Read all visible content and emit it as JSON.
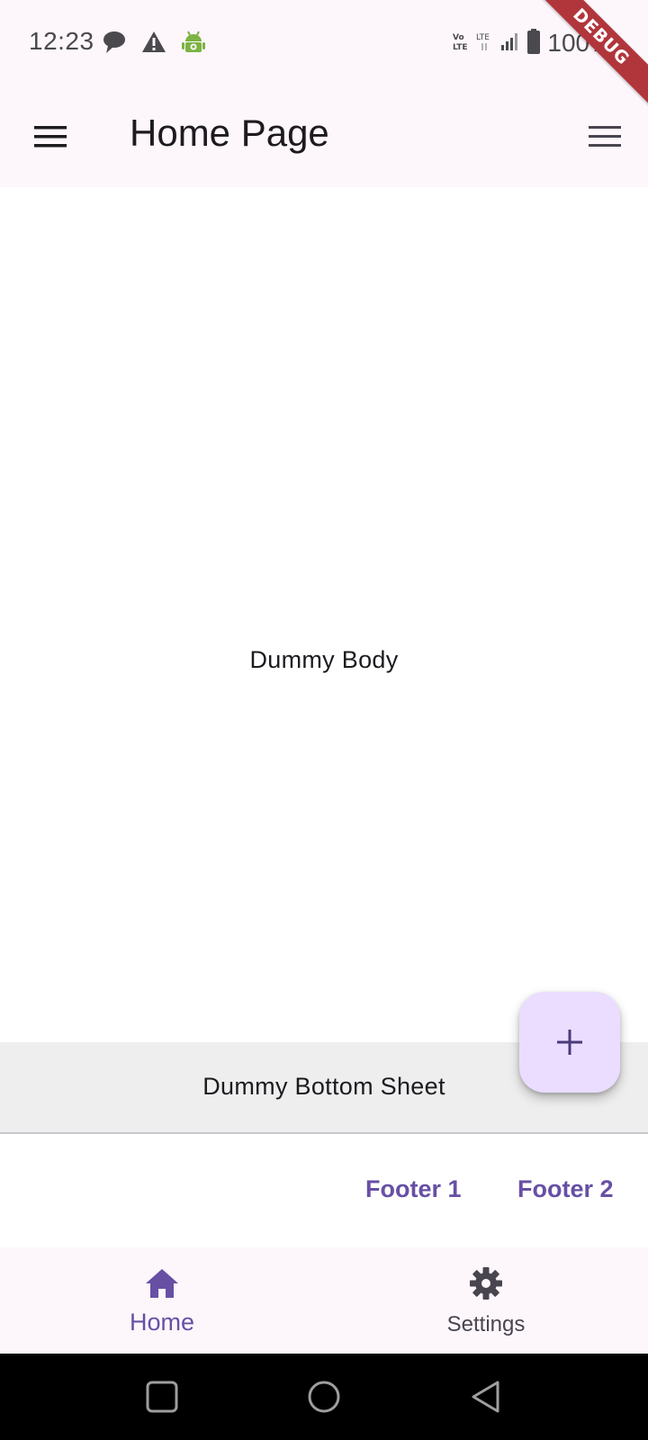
{
  "status_bar": {
    "time": "12:23",
    "icons_left": [
      "chat-bubble-icon",
      "warning-icon",
      "android-debug-icon"
    ],
    "icons_right": [
      "volte-icon",
      "lte-icon",
      "signal-icon",
      "battery-icon"
    ],
    "battery_text": "100%"
  },
  "debug_banner": {
    "label": "DEBUG",
    "color": "#b1363c"
  },
  "app_bar": {
    "title": "Home Page",
    "leading_icon": "menu-icon",
    "trailing_icon": "menu-icon",
    "background": "#fdf7fc"
  },
  "body": {
    "text": "Dummy Body"
  },
  "bottom_sheet": {
    "text": "Dummy Bottom Sheet",
    "background": "#eeeeee"
  },
  "fab": {
    "icon": "plus-icon",
    "background": "#eaddff"
  },
  "footer": {
    "buttons": [
      {
        "label": "Footer 1"
      },
      {
        "label": "Footer 2"
      }
    ],
    "accent": "#6750a4"
  },
  "bottom_nav": {
    "items": [
      {
        "label": "Home",
        "icon": "home-icon",
        "selected": true
      },
      {
        "label": "Settings",
        "icon": "settings-gear-icon",
        "selected": false
      }
    ]
  },
  "system_nav": {
    "buttons": [
      "recents-icon",
      "home-circle-icon",
      "back-icon"
    ]
  }
}
